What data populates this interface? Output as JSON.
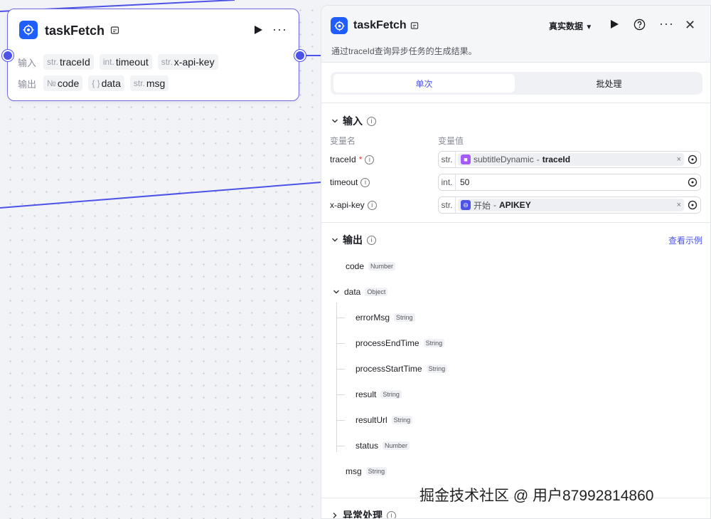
{
  "node": {
    "title": "taskFetch",
    "input_label": "输入",
    "output_label": "输出",
    "inputs": [
      {
        "type": "str.",
        "name": "traceId"
      },
      {
        "type": "int.",
        "name": "timeout"
      },
      {
        "type": "str.",
        "name": "x-api-key"
      }
    ],
    "outputs": [
      {
        "type": "№",
        "name": "code"
      },
      {
        "type": "{ }",
        "name": "data"
      },
      {
        "type": "str.",
        "name": "msg"
      }
    ]
  },
  "panel": {
    "title": "taskFetch",
    "data_mode": "真实数据",
    "description": "通过traceId查询异步任务的生成结果。",
    "tabs": {
      "single": "单次",
      "batch": "批处理"
    },
    "input_section": "输入",
    "col_name": "变量名",
    "col_value": "变量值",
    "params": [
      {
        "name": "traceId",
        "required": "*",
        "type": "str.",
        "source": "subtitleDynamic",
        "sep": "-",
        "var": "traceId",
        "icon": "cube-icon",
        "color": "#a35cf7"
      },
      {
        "name": "timeout",
        "type": "int.",
        "value": "50"
      },
      {
        "name": "x-api-key",
        "type": "str.",
        "source": "开始",
        "sep": "-",
        "var": "APIKEY",
        "icon": "start-icon",
        "color": "#4d53e8"
      }
    ],
    "output_section": "输出",
    "see_example": "查看示例",
    "outputs": [
      {
        "name": "code",
        "type": "Number"
      },
      {
        "name": "data",
        "type": "Object"
      },
      {
        "name": "errorMsg",
        "type": "String"
      },
      {
        "name": "processEndTime",
        "type": "String"
      },
      {
        "name": "processStartTime",
        "type": "String"
      },
      {
        "name": "result",
        "type": "String"
      },
      {
        "name": "resultUrl",
        "type": "String"
      },
      {
        "name": "status",
        "type": "Number"
      },
      {
        "name": "msg",
        "type": "String"
      }
    ],
    "exception_section": "异常处理"
  },
  "watermark": "掘金技术社区 @ 用户8799281486​0",
  "colors": {
    "accent": "#4d53e8",
    "brand": "#1f5efc"
  }
}
